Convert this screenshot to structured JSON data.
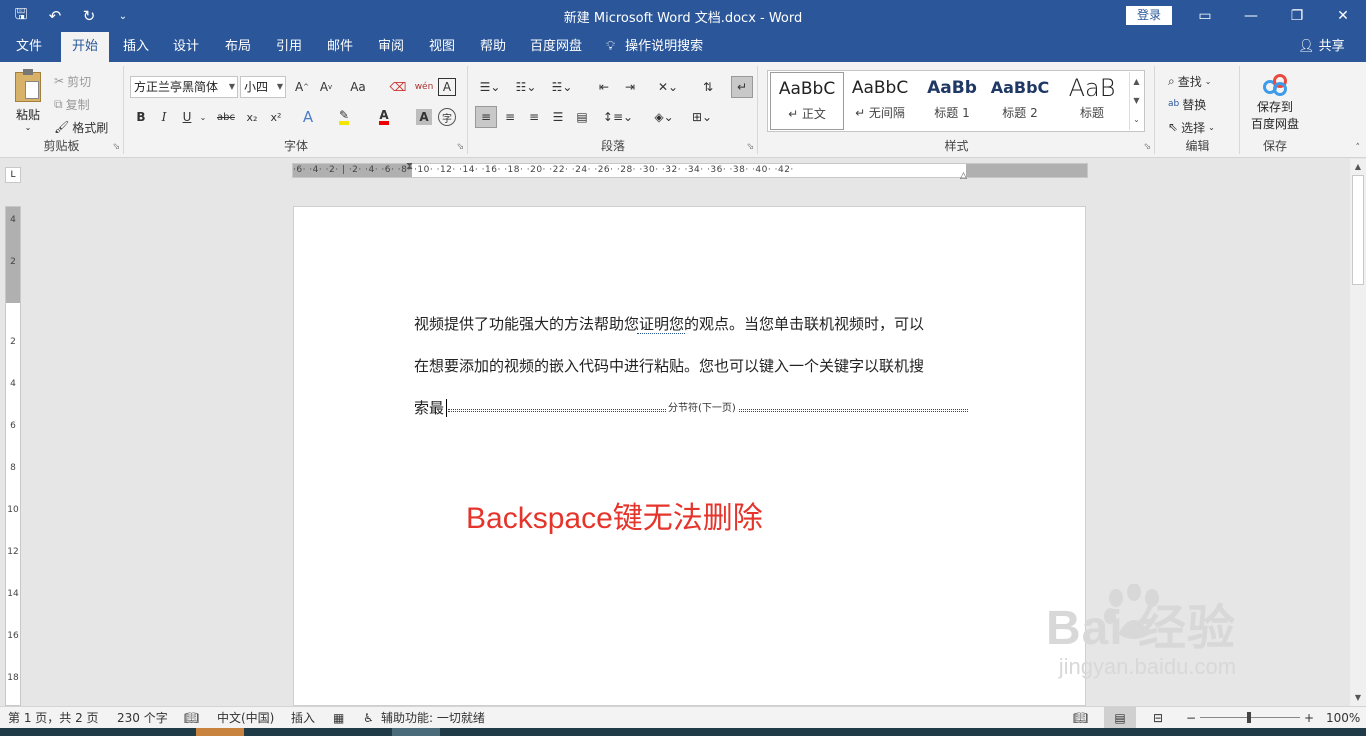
{
  "titlebar": {
    "doc_title": "新建 Microsoft Word 文档.docx  -  Word",
    "login_label": "登录",
    "qat_icons": [
      "save-icon",
      "undo-icon",
      "redo-icon",
      "customize-qat-icon"
    ]
  },
  "tabs": [
    {
      "label": "文件"
    },
    {
      "label": "开始"
    },
    {
      "label": "插入"
    },
    {
      "label": "设计"
    },
    {
      "label": "布局"
    },
    {
      "label": "引用"
    },
    {
      "label": "邮件"
    },
    {
      "label": "审阅"
    },
    {
      "label": "视图"
    },
    {
      "label": "帮助"
    },
    {
      "label": "百度网盘"
    }
  ],
  "tellme": "操作说明搜索",
  "share_label": "共享",
  "ribbon": {
    "clipboard": {
      "name": "剪贴板",
      "paste": "粘贴",
      "cut": "剪切",
      "copy": "复制",
      "format_painter": "格式刷"
    },
    "font": {
      "name": "字体",
      "font_family": "方正兰亭黑简体",
      "font_size": "小四",
      "bold": "B",
      "italic": "I",
      "underline": "U",
      "strike": "abc",
      "sub": "x₂",
      "sup": "x²",
      "grow": "A˄",
      "shrink": "A˅",
      "case": "Aa",
      "pinyin": "wén",
      "border_char": "A",
      "char_shading": "A",
      "enclose": "字"
    },
    "paragraph": {
      "name": "段落"
    },
    "styles": {
      "name": "样式",
      "items": [
        {
          "sample": "AaBbC",
          "label": "↵ 正文"
        },
        {
          "sample": "AaBbC",
          "label": "↵ 无间隔"
        },
        {
          "sample": "AaBb",
          "label": "标题 1"
        },
        {
          "sample": "AaBbC",
          "label": "标题 2"
        },
        {
          "sample": "AaB",
          "label": "标题"
        }
      ]
    },
    "editing": {
      "name": "编辑",
      "find": "查找",
      "replace": "替换",
      "select": "选择"
    },
    "save": {
      "name": "保存",
      "save_to": "保存到",
      "baidu": "百度网盘"
    }
  },
  "ruler": {
    "h_numbers": "·6· ·4· ·2·  |  ·2· ·4· ·6· ·8· ·10· ·12· ·14· ·16· ·18· ·20· ·22· ·24· ·26· ·28· ·30· ·32· ·34· ·36· ·38· ·40· ·42·",
    "v_numbers": [
      "4",
      "2",
      "",
      "2",
      "4",
      "6",
      "8",
      "10",
      "12",
      "14",
      "16",
      "18"
    ]
  },
  "document": {
    "line1": "视频提供了功能强大的方法帮助您证明您的观点。当您单击联机视频时，可以",
    "line2": "在想要添加的视频的嵌入代码中进行粘贴。您也可以键入一个关键字以联机搜",
    "line3": "索最",
    "section_break": "分节符(下一页)",
    "overlay_text": "Backspace键无法删除"
  },
  "status": {
    "page": "第 1 页，共 2 页",
    "words": "230 个字",
    "language": "中文(中国)",
    "mode": "插入",
    "accessibility": "辅助功能: 一切就绪",
    "zoom": "100%"
  },
  "watermark": {
    "brand": "Bai  经验",
    "url": "jingyan.baidu.com"
  },
  "colors": {
    "accent": "#2b579a",
    "overlay_red": "#e5342b"
  }
}
